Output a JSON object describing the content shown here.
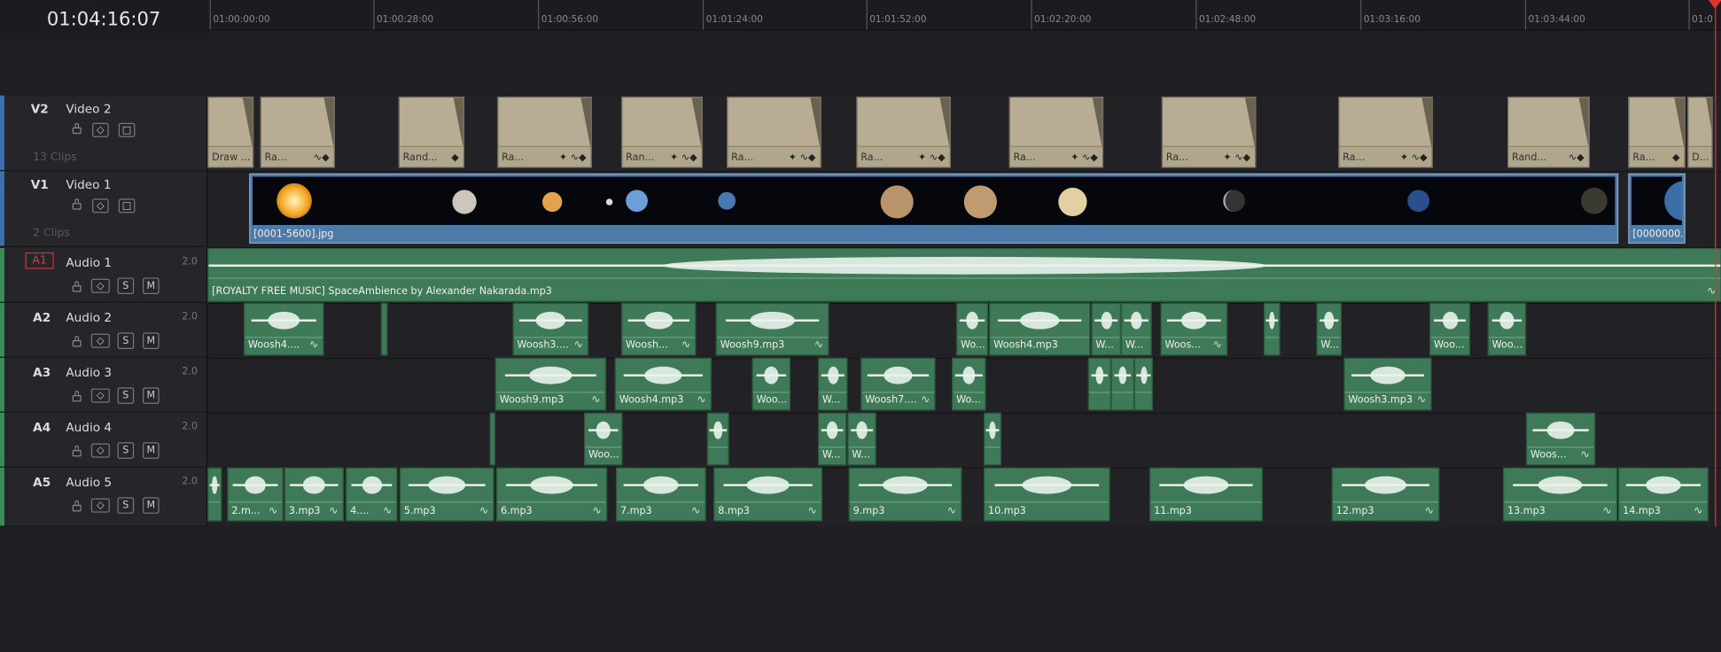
{
  "timecode": "01:04:16:07",
  "ruler": [
    "01:00:00:00",
    "01:00:28:00",
    "01:00:56:00",
    "01:01:24:00",
    "01:01:52:00",
    "01:02:20:00",
    "01:02:48:00",
    "01:03:16:00",
    "01:03:44:00",
    "01:0"
  ],
  "colors": {
    "video_bar": "#3f6fa8",
    "audio_bar": "#3f8a5a",
    "playhead": "#dd3333"
  },
  "tracks": {
    "v2": {
      "id": "V2",
      "name": "Video 2",
      "clips": "13 Clips"
    },
    "v1": {
      "id": "V1",
      "name": "Video 1",
      "clips": "2 Clips"
    },
    "a1": {
      "id": "A1",
      "name": "Audio 1",
      "level": "2.0",
      "s": "S",
      "m": "M"
    },
    "a2": {
      "id": "A2",
      "name": "Audio 2",
      "level": "2.0",
      "s": "S",
      "m": "M"
    },
    "a3": {
      "id": "A3",
      "name": "Audio 3",
      "level": "2.0",
      "s": "S",
      "m": "M"
    },
    "a4": {
      "id": "A4",
      "name": "Audio 4",
      "level": "2.0",
      "s": "S",
      "m": "M"
    },
    "a5": {
      "id": "A5",
      "name": "Audio 5",
      "level": "2.0",
      "s": "S",
      "m": "M"
    }
  },
  "v2_clips": [
    "Draw ...",
    "Ra...",
    "Rand...",
    "Ra...",
    "Ran...",
    "Ra...",
    "Ra...",
    "Ra...",
    "Ra...",
    "Ra...",
    "Rand...",
    "Ra...",
    "D..."
  ],
  "v1_clips": [
    "[0001-5600].jpg",
    "[0000000..."
  ],
  "a1_clip": "[ROYALTY FREE MUSIC] SpaceAmbience by Alexander Nakarada.mp3",
  "a2_clips": [
    "Woosh4....",
    "",
    "Woosh3....",
    "Woosh...",
    "Woosh9.mp3",
    "Wo...",
    "Woosh4.mp3",
    "W...",
    "W...",
    "Woos...",
    "",
    "W...",
    "Woo...",
    "Woo..."
  ],
  "a3_clips": [
    "Woosh9.mp3",
    "Woosh4.mp3",
    "Woo...",
    "W...",
    "Woosh7....",
    "Wo...",
    "",
    "",
    "",
    "Woosh3.mp3"
  ],
  "a4_clips": [
    "",
    "Woo...",
    "",
    "W...",
    "W...",
    "",
    "Woos..."
  ],
  "a5_clips": [
    "",
    "2.m...",
    "3.mp3",
    "4....",
    "5.mp3",
    "6.mp3",
    "7.mp3",
    "8.mp3",
    "9.mp3",
    "10.mp3",
    "11.mp3",
    "12.mp3",
    "13.mp3",
    "14.mp3"
  ]
}
